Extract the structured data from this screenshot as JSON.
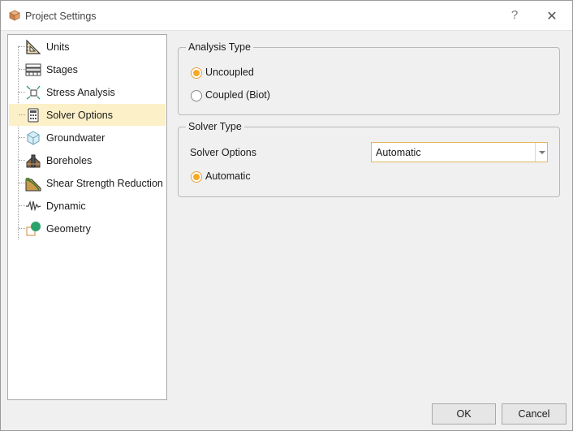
{
  "window": {
    "title": "Project Settings",
    "help_glyph": "?",
    "close_glyph": "✕"
  },
  "tree": {
    "items": [
      {
        "label": "Units",
        "icon": "units-icon"
      },
      {
        "label": "Stages",
        "icon": "stages-icon"
      },
      {
        "label": "Stress Analysis",
        "icon": "stress-analysis-icon"
      },
      {
        "label": "Solver Options",
        "icon": "solver-options-icon",
        "selected": true
      },
      {
        "label": "Groundwater",
        "icon": "groundwater-icon"
      },
      {
        "label": "Boreholes",
        "icon": "boreholes-icon"
      },
      {
        "label": "Shear Strength Reduction",
        "icon": "shear-strength-reduction-icon"
      },
      {
        "label": "Dynamic",
        "icon": "dynamic-icon"
      },
      {
        "label": "Geometry",
        "icon": "geometry-icon"
      }
    ]
  },
  "analysis_type": {
    "title": "Analysis Type",
    "options": [
      {
        "label": "Uncoupled",
        "checked": true
      },
      {
        "label": "Coupled (Biot)",
        "checked": false
      }
    ]
  },
  "solver_type": {
    "title": "Solver Type",
    "solver_options_label": "Solver Options",
    "solver_options_value": "Automatic",
    "radio_label": "Automatic",
    "radio_checked": true
  },
  "buttons": {
    "ok": "OK",
    "cancel": "Cancel"
  },
  "colors": {
    "selection": "#fcf0c8",
    "radio_accent": "#f7a825",
    "focus_border": "#e0b85a"
  }
}
